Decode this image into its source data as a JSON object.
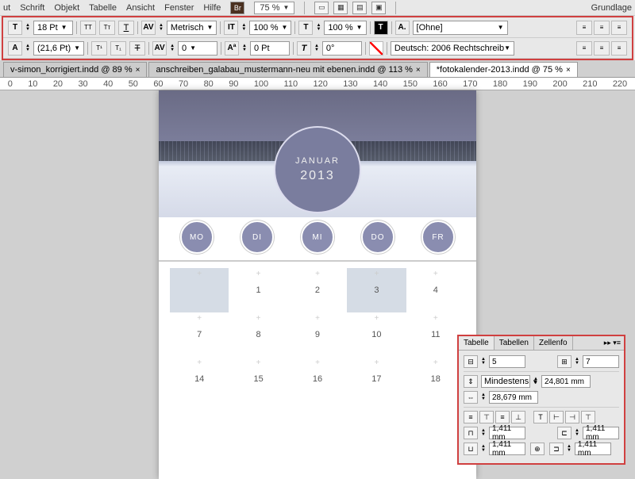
{
  "menu": {
    "items": [
      "ut",
      "Schrift",
      "Objekt",
      "Tabelle",
      "Ansicht",
      "Fenster",
      "Hilfe"
    ],
    "br": "Br",
    "zoom": "75 %",
    "right": "Grundlage"
  },
  "toolbar1": {
    "font_size": "18 Pt",
    "kerning_mode": "Metrisch",
    "scale_h": "100 %",
    "scale_v": "100 %",
    "char_style": "[Ohne]"
  },
  "toolbar2": {
    "leading": "(21,6 Pt)",
    "tracking": "0",
    "baseline": "0 Pt",
    "skew": "0°",
    "lang": "Deutsch: 2006 Rechtschreib"
  },
  "tabs": {
    "t1": "v-simon_korrigiert.indd @ 89 %",
    "t2": "anschreiben_galabau_mustermann-neu mit ebenen.indd @ 113 %",
    "t3": "*fotokalender-2013.indd @ 75 %"
  },
  "ruler": [
    "0",
    "10",
    "20",
    "30",
    "40",
    "50",
    "60",
    "70",
    "80",
    "90",
    "100",
    "110",
    "120",
    "130",
    "140",
    "150",
    "160",
    "170",
    "180",
    "190",
    "200",
    "210",
    "220"
  ],
  "calendar": {
    "month": "JANUAR",
    "year": "2013",
    "days": [
      "MO",
      "DI",
      "MI",
      "DO",
      "FR"
    ],
    "cells": [
      "",
      "1",
      "2",
      "3",
      "4",
      "7",
      "8",
      "9",
      "10",
      "11",
      "14",
      "15",
      "16",
      "17",
      "18"
    ]
  },
  "panel": {
    "tabs": [
      "Tabelle",
      "Tabellen",
      "Zellenfo"
    ],
    "rows": "5",
    "cols": "7",
    "height_mode": "Mindestens",
    "row_h": "24,801 mm",
    "col_w": "28,679 mm",
    "inset": "1,411 mm"
  }
}
